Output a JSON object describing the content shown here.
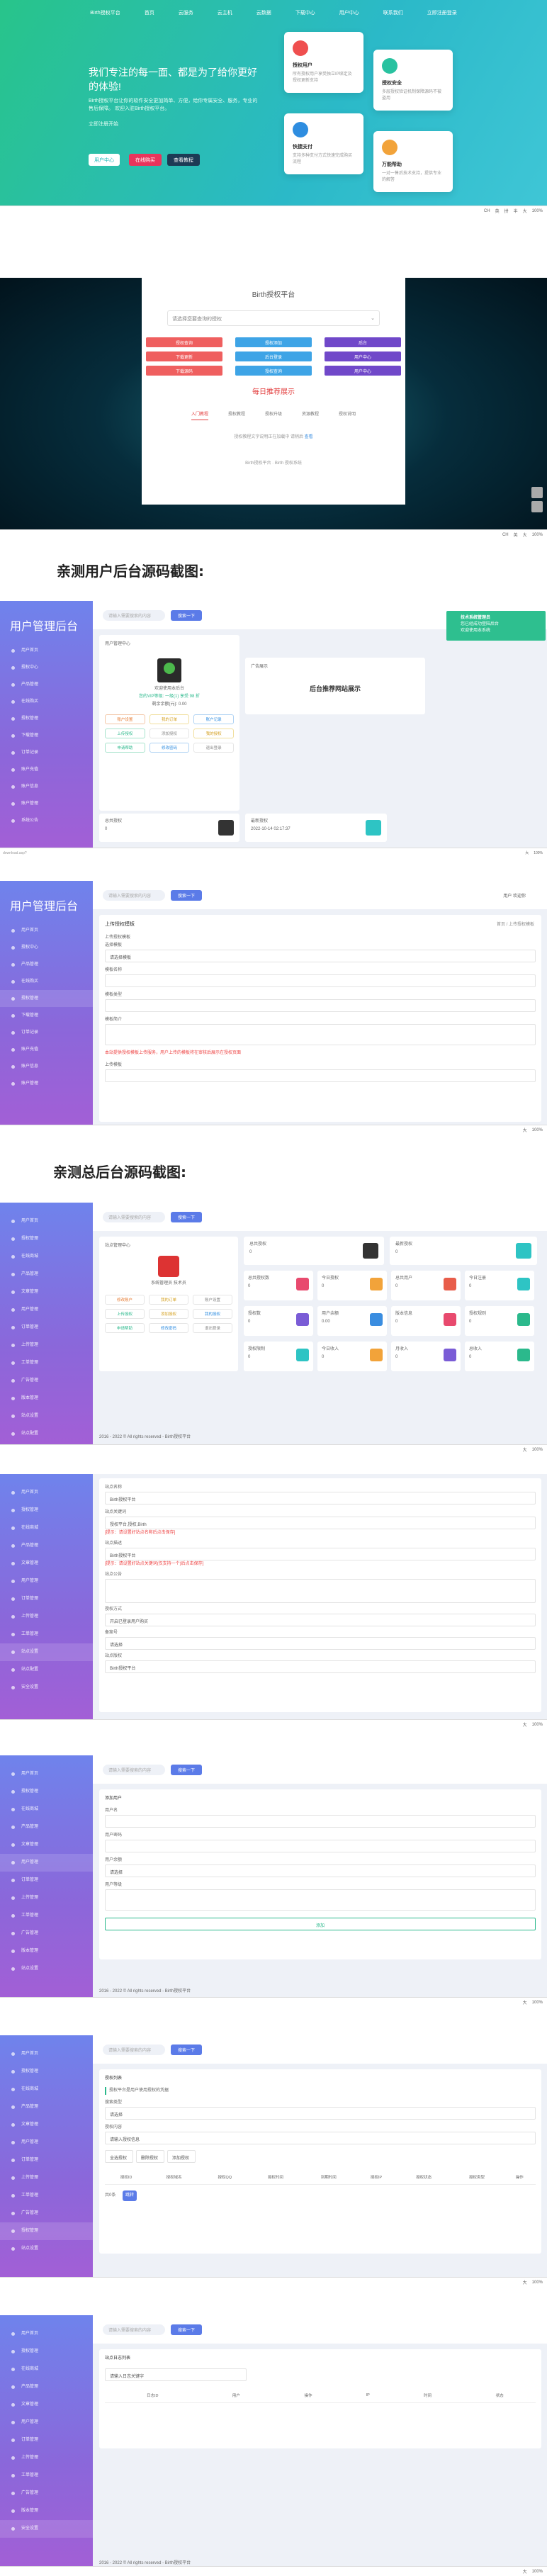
{
  "hero": {
    "nav": [
      "Birth授权平台",
      "首页",
      "云服务",
      "云主机",
      "云数据",
      "下载中心",
      "用户中心",
      "联系我们",
      "立即注册登录"
    ],
    "title": "我们专注的每一面、都是为了给你更好的体验!",
    "desc": "Birth授权平台让你的软件安全更加简单、方便，给你专属安全、服务，专业的售后保障。 欢迎入驻Birth授权平台。",
    "desc2": "立即注册开始",
    "buttons": [
      "用户中心",
      "在线购买",
      "查看教程"
    ],
    "cards": [
      {
        "title": "授权用户",
        "text": "所有授权用户享受独立IP绑定及授权更新支持"
      },
      {
        "title": "授权安全",
        "text": "多层授权验证机制保障源码不被盗用"
      },
      {
        "title": "快捷支付",
        "text": "支持多种支付方式快速完成购买流程"
      },
      {
        "title": "万能帮助",
        "text": "一对一售后技术支持，提供专业的解答"
      }
    ]
  },
  "statusbar": [
    "CH",
    "英",
    "拼",
    "半",
    "简",
    "中",
    "大",
    "设置",
    "下载",
    "帮助",
    "OFF",
    "英",
    "100%"
  ],
  "auth": {
    "title": "Birth授权平台",
    "select": "请选择您要查询的授权",
    "buttons": [
      "授权查询",
      "授权添加",
      "后台",
      "下载更新",
      "后台登录",
      "用户中心",
      "下载源码",
      "授权查询",
      "用户中心"
    ],
    "recommend": "每日推荐展示",
    "tabs": [
      "入门教程",
      "授权教程",
      "授权升级",
      "资源教程",
      "授权说明"
    ],
    "note": "授权教程文字说明正在加载中 请稍后",
    "notelink": "查看",
    "footer": "Birth授权平台 ·  Birth 授权系统"
  },
  "heading1": "亲测用户后台源码截图:",
  "heading2": "亲测总后台源码截图:",
  "user1": {
    "logo": "用户管理后台",
    "menu": [
      "用户首页",
      "授权中心",
      "产品管理",
      "在线购买",
      "授权管理",
      "下载管理",
      "订单记录",
      "账户充值",
      "账户信息",
      "账户管理",
      "系统公告",
      "退出登录"
    ],
    "search": "请输入需要搜索的内容",
    "searchbtn": "搜索一下",
    "panel": "用户管理中心",
    "nick": "欢迎使用本后台",
    "vip": "您的VIP等级: 一级(1) 享受 98 折",
    "balance": "剩余余额(元): 0.00",
    "mini": [
      "账户设置",
      "我的订单",
      "账户记录",
      "上传授权",
      "添加授权",
      "我的授权",
      "申请帮助",
      "修改密码",
      "退出登录"
    ],
    "ad": "广告展示",
    "adtext": "后台推荐网站展示",
    "stat1": "总共授权",
    "stat1v": "0",
    "stat2": "最新授权",
    "stat2v": "2022-10-14 02:17:37",
    "toast": [
      "技术系统管理员",
      "您已经成功登陆后台",
      "欢迎使用本系统"
    ],
    "url": "download.asp?"
  },
  "user2": {
    "avatar": "用户",
    "welcome": "欢迎你",
    "title": "上传授权模板",
    "labels": [
      "上传授权模板",
      "选择模板",
      "模板名称",
      "模板类型",
      "模板简介",
      "上传模板"
    ],
    "values": [
      "请选择模板",
      "",
      "",
      "",
      ""
    ],
    "note": "本站提供授权模板上传服务，用户上传的模板将在审核后展示在授权页面",
    "crumb": "首页 / 上传授权模板"
  },
  "admin1": {
    "menu": [
      "用户首页",
      "授权管理",
      "在线商城",
      "产品管理",
      "文章管理",
      "用户管理",
      "订单管理",
      "上传管理",
      "工单管理",
      "广告管理",
      "版本管理",
      "站点设置",
      "站点配置",
      "安全设置",
      "更多设置",
      "退出系统"
    ],
    "panel": "站点管理中心",
    "name": "系统管理员",
    "role": "技术员",
    "levels": [
      "修改账户",
      "我的订单",
      "账户设置",
      "上传授权",
      "添加授权",
      "我的授权",
      "申请帮助",
      "修改密码",
      "退出登录"
    ],
    "stats": [
      {
        "k": "总共授权",
        "v": "0"
      },
      {
        "k": "最新授权",
        "v": "0"
      }
    ],
    "tiles": [
      {
        "k": "总共授权数",
        "v": "0"
      },
      {
        "k": "今日授权",
        "v": "0"
      },
      {
        "k": "总共用户",
        "v": "0"
      },
      {
        "k": "今日注册",
        "v": "0"
      },
      {
        "k": "授权数",
        "v": "0"
      },
      {
        "k": "用户余额",
        "v": "0.00"
      },
      {
        "k": "版本信息",
        "v": "0"
      },
      {
        "k": "授权规则",
        "v": "0"
      },
      {
        "k": "授权限制",
        "v": "0"
      },
      {
        "k": "今日收入",
        "v": "0"
      },
      {
        "k": "月收入",
        "v": "0"
      },
      {
        "k": "总收入",
        "v": "0"
      }
    ],
    "footer": "2016 - 2022 © All rights reserved - Birth授权平台"
  },
  "admin2": {
    "labels": [
      "站点名称",
      "站点关键词",
      "站点描述",
      "站点公告",
      "站点logo",
      "站点版权",
      "授权方式",
      "备案号"
    ],
    "warn": "[提示：请设置好站点名称后点击保存]",
    "warn2": "[提示：请设置好站点关键词(仅支持一个)后点击保存]",
    "values": [
      "Birth授权平台",
      "授权平台,授权,Birth",
      "Birth授权平台",
      "",
      "",
      "Birth授权平台",
      "开启已登录用户购买",
      "请选择"
    ]
  },
  "admin3": {
    "title": "添加用户",
    "labels": [
      "用户名",
      "用户密码",
      "用户余额",
      "用户等级"
    ],
    "values": [
      "",
      "",
      "请选择",
      ""
    ],
    "save": "添加"
  },
  "admin4": {
    "title": "授权列表",
    "tip": "授权平台是用户使用授权的凭据",
    "labels": [
      "搜索类型",
      "授权内容"
    ],
    "values": [
      "请选择",
      "请输入授权信息"
    ],
    "btns": [
      "全选授权",
      "删除授权",
      "添加授权"
    ],
    "cols": [
      "授权ID",
      "授权域名",
      "授权QQ",
      "授权时间",
      "到期时间",
      "授权IP",
      "授权状态",
      "授权类型",
      "操作"
    ],
    "page": "共0条",
    "go": "跳转"
  },
  "admin5": {
    "title": "站点日志列表",
    "cols": [
      "日志ID",
      "用户",
      "操作",
      "IP",
      "时间",
      "状态"
    ],
    "search": "请输入日志关键字",
    "footer": "2016 - 2022 © All rights reserved - Birth授权平台"
  }
}
